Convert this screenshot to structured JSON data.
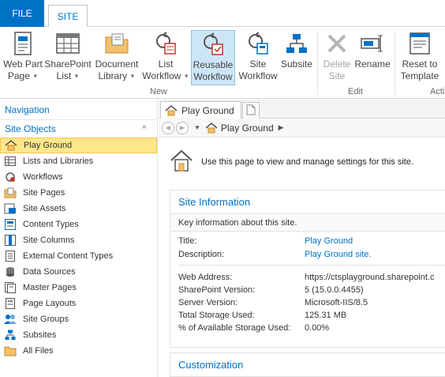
{
  "tabs": {
    "file": "FILE",
    "site": "SITE"
  },
  "ribbon": {
    "groups": [
      {
        "label": "New"
      },
      {
        "label": "Edit"
      },
      {
        "label": "Acti"
      }
    ],
    "buttons": [
      {
        "line1": "Web Part",
        "line2": "Page",
        "icon": "web-part-page-icon"
      },
      {
        "line1": "SharePoint",
        "line2": "List",
        "icon": "sharepoint-list-icon"
      },
      {
        "line1": "Document",
        "line2": "Library",
        "icon": "document-library-icon"
      },
      {
        "line1": "List",
        "line2": "Workflow",
        "icon": "list-workflow-icon"
      },
      {
        "line1": "Reusable",
        "line2": "Workflow",
        "icon": "reusable-workflow-icon"
      },
      {
        "line1": "Site",
        "line2": "Workflow",
        "icon": "site-workflow-icon"
      },
      {
        "line1": "Subsite",
        "line2": "",
        "icon": "subsite-icon"
      },
      {
        "line1": "Delete",
        "line2": "Site",
        "icon": "delete-icon"
      },
      {
        "line1": "Rename",
        "line2": "",
        "icon": "rename-icon"
      },
      {
        "line1": "Reset to",
        "line2": "Template",
        "icon": "reset-template-icon"
      }
    ]
  },
  "navigation": {
    "header": "Navigation",
    "section": "Site Objects",
    "items": [
      {
        "label": "Play Ground",
        "icon": "home-icon"
      },
      {
        "label": "Lists and Libraries",
        "icon": "list-icon"
      },
      {
        "label": "Workflows",
        "icon": "workflow-icon"
      },
      {
        "label": "Site Pages",
        "icon": "pages-icon"
      },
      {
        "label": "Site Assets",
        "icon": "assets-icon"
      },
      {
        "label": "Content Types",
        "icon": "content-types-icon"
      },
      {
        "label": "Site Columns",
        "icon": "columns-icon"
      },
      {
        "label": "External Content Types",
        "icon": "external-content-icon"
      },
      {
        "label": "Data Sources",
        "icon": "database-icon"
      },
      {
        "label": "Master Pages",
        "icon": "master-pages-icon"
      },
      {
        "label": "Page Layouts",
        "icon": "page-layouts-icon"
      },
      {
        "label": "Site Groups",
        "icon": "groups-icon"
      },
      {
        "label": "Subsites",
        "icon": "subsites-icon"
      },
      {
        "label": "All Files",
        "icon": "folder-icon"
      }
    ]
  },
  "document": {
    "tab_title": "Play Ground",
    "breadcrumb": "Play Ground",
    "intro": "Use this page to view and manage settings for this site.",
    "site_info": {
      "title": "Site Information",
      "description": "Key information about this site.",
      "fields": [
        {
          "label": "Title:",
          "value": "Play Ground",
          "link": true
        },
        {
          "label": "Description:",
          "value": "Play Ground site.",
          "link": true
        },
        {
          "label": "Web Address:",
          "value": "https://ctsplayground.sharepoint.c",
          "link": false
        },
        {
          "label": "SharePoint Version:",
          "value": "5 (15.0.0.4455)",
          "link": false
        },
        {
          "label": "Server Version:",
          "value": "Microsoft-IIS/8.5",
          "link": false
        },
        {
          "label": "Total Storage Used:",
          "value": "125.31 MB",
          "link": false
        },
        {
          "label": "% of Available Storage Used:",
          "value": "0.00%",
          "link": false
        }
      ]
    },
    "customization": {
      "title": "Customization"
    }
  },
  "colors": {
    "accent": "#0072c6",
    "selection": "#fde68a"
  }
}
